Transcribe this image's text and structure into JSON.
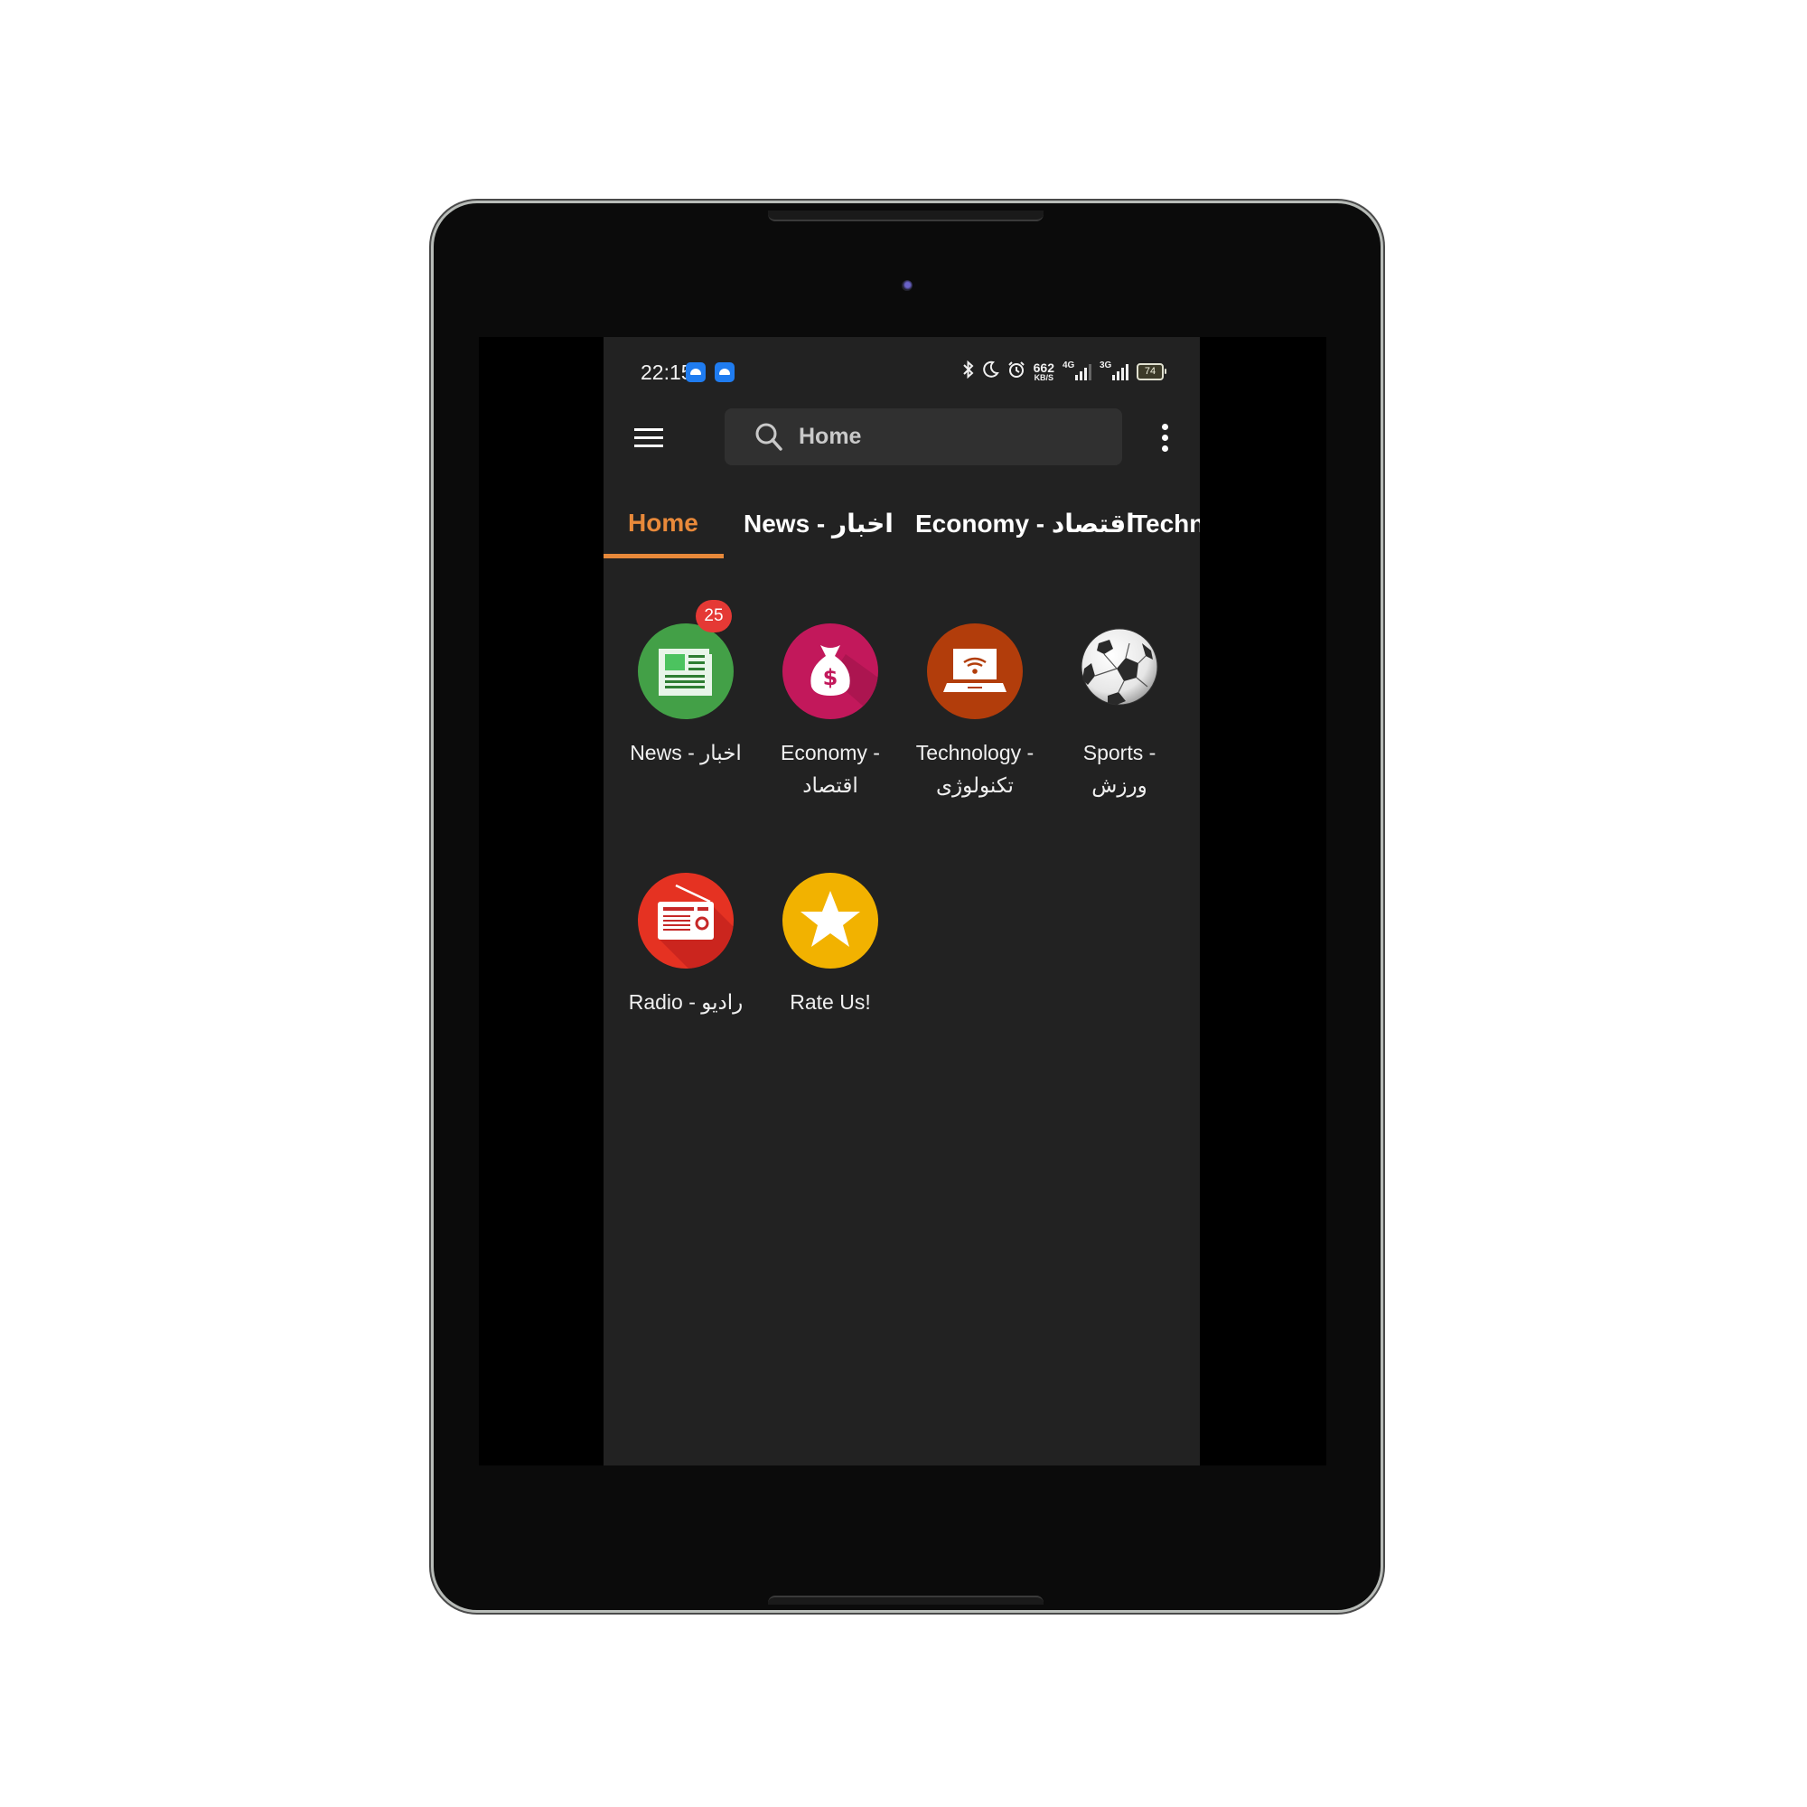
{
  "status_bar": {
    "time": "22:15",
    "notification_icons": [
      "android-app-icon",
      "android-app-icon"
    ],
    "icons": [
      "bluetooth-icon",
      "do-not-disturb-moon-icon",
      "alarm-icon"
    ],
    "network_speed_value": "662",
    "network_speed_unit": "KB/S",
    "sim1_network": "4G",
    "sim2_network": "3G",
    "battery_level": "74"
  },
  "app_bar": {
    "menu_icon": "hamburger-menu-icon",
    "search_text": "Home",
    "overflow_icon": "more-vert-icon"
  },
  "tabs": [
    {
      "label": "Home",
      "active": true
    },
    {
      "label": "News - اخبار",
      "active": false
    },
    {
      "label": "Economy - اقتصاد",
      "active": false
    },
    {
      "label": "Technology - تکنولوژی",
      "active": false
    }
  ],
  "grid": [
    {
      "label_en": "News -",
      "label_fa": "اخبار",
      "label": "News - اخبار",
      "icon": "newspaper-icon",
      "color": "#43a047",
      "badge": "25"
    },
    {
      "label_en": "Economy -",
      "label_fa": "اقتصاد",
      "icon": "money-bag-icon",
      "color": "#c2185b"
    },
    {
      "label_en": "Technology -",
      "label_fa": "تکنولوژی",
      "icon": "laptop-wifi-icon",
      "color": "#b23d0b"
    },
    {
      "label_en": "Sports -",
      "label_fa": "ورزش",
      "icon": "soccer-ball-icon",
      "color": "#ffffff"
    },
    {
      "label": "Radio - رادیو",
      "icon": "radio-icon",
      "color": "#e53222"
    },
    {
      "label": "Rate Us!",
      "icon": "star-icon",
      "color": "#f2b200"
    }
  ],
  "colors": {
    "accent": "#e8893a",
    "background": "#222222",
    "search_background": "#303030",
    "badge": "#e53935"
  }
}
